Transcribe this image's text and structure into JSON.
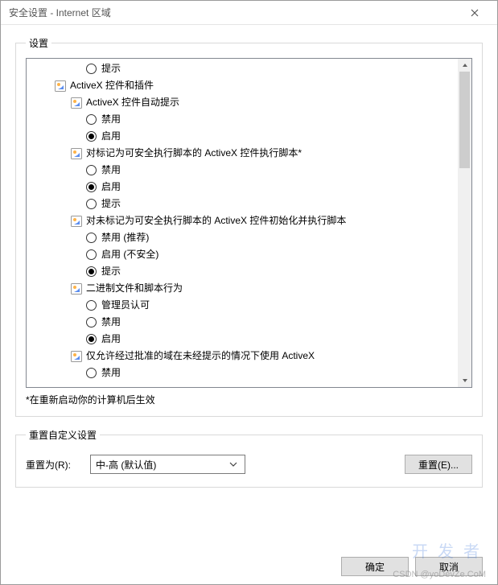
{
  "window": {
    "title": "安全设置 - Internet 区域"
  },
  "settings": {
    "legend": "设置",
    "note": "*在重新启动你的计算机后生效",
    "tree": [
      {
        "type": "radio",
        "indent": 3,
        "checked": false,
        "label": "提示"
      },
      {
        "type": "category",
        "indent": 1,
        "icon": "activex",
        "label": "ActiveX 控件和插件"
      },
      {
        "type": "category",
        "indent": 2,
        "icon": "activex",
        "label": "ActiveX 控件自动提示"
      },
      {
        "type": "radio",
        "indent": 3,
        "checked": false,
        "label": "禁用"
      },
      {
        "type": "radio",
        "indent": 3,
        "checked": true,
        "label": "启用"
      },
      {
        "type": "category",
        "indent": 2,
        "icon": "activex",
        "label": "对标记为可安全执行脚本的 ActiveX 控件执行脚本*"
      },
      {
        "type": "radio",
        "indent": 3,
        "checked": false,
        "label": "禁用"
      },
      {
        "type": "radio",
        "indent": 3,
        "checked": true,
        "label": "启用"
      },
      {
        "type": "radio",
        "indent": 3,
        "checked": false,
        "label": "提示"
      },
      {
        "type": "category",
        "indent": 2,
        "icon": "activex",
        "label": "对未标记为可安全执行脚本的 ActiveX 控件初始化并执行脚本"
      },
      {
        "type": "radio",
        "indent": 3,
        "checked": false,
        "label": "禁用 (推荐)"
      },
      {
        "type": "radio",
        "indent": 3,
        "checked": false,
        "label": "启用 (不安全)"
      },
      {
        "type": "radio",
        "indent": 3,
        "checked": true,
        "label": "提示"
      },
      {
        "type": "category",
        "indent": 2,
        "icon": "activex",
        "label": "二进制文件和脚本行为"
      },
      {
        "type": "radio",
        "indent": 3,
        "checked": false,
        "label": "管理员认可"
      },
      {
        "type": "radio",
        "indent": 3,
        "checked": false,
        "label": "禁用"
      },
      {
        "type": "radio",
        "indent": 3,
        "checked": true,
        "label": "启用"
      },
      {
        "type": "category",
        "indent": 2,
        "icon": "activex",
        "label": "仅允许经过批准的域在未经提示的情况下使用 ActiveX"
      },
      {
        "type": "radio",
        "indent": 3,
        "checked": false,
        "label": "禁用"
      }
    ]
  },
  "reset": {
    "legend": "重置自定义设置",
    "label": "重置为(R):",
    "selected": "中-高 (默认值)",
    "button": "重置(E)..."
  },
  "buttons": {
    "ok": "确定",
    "cancel": "取消"
  },
  "watermark": {
    "big": "开发者",
    "small": "CSDN @yoDevZe.CoM"
  }
}
